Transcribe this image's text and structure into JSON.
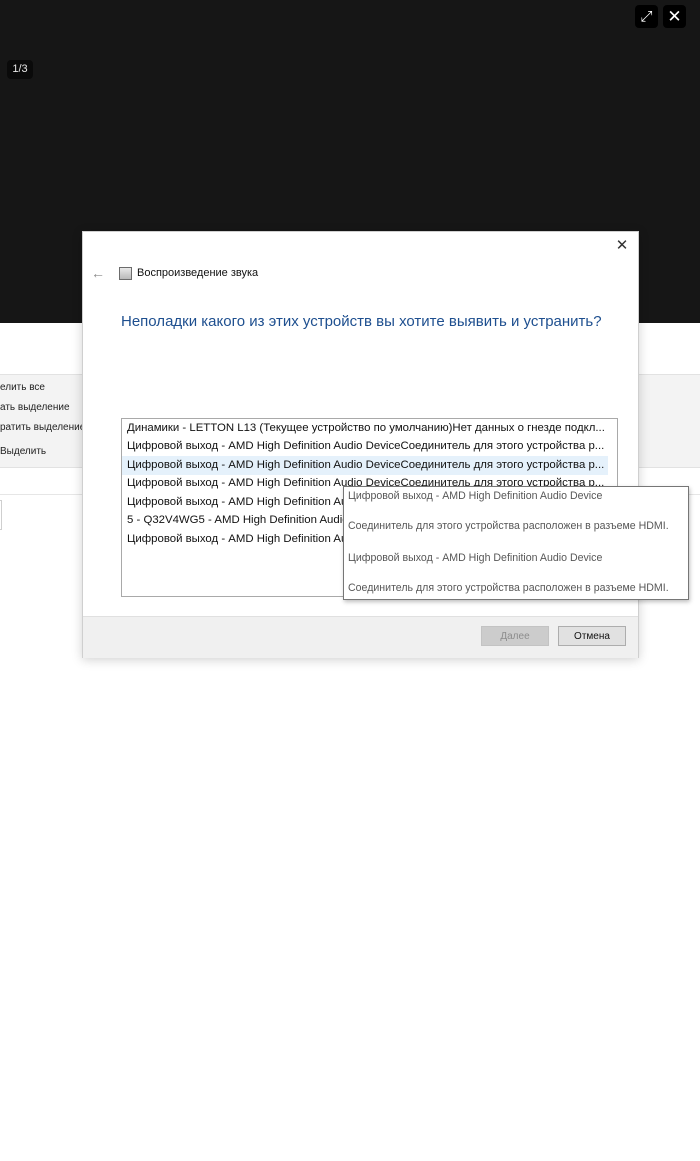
{
  "viewer": {
    "counter": "1/3",
    "expand_icon": "expand-icon",
    "close_icon": "close-icon"
  },
  "background_app": {
    "items": [
      "елить все",
      "ать выделение",
      "ратить выделение",
      "Выделить"
    ]
  },
  "dialog": {
    "title": "Воспроизведение звука",
    "heading": "Неполадки какого из этих устройств вы хотите выявить и устранить?",
    "devices": [
      "Динамики - LETTON  L13 (Текущее устройство по умолчанию)Нет данных о гнезде подкл...",
      "Цифровой выход - AMD High Definition Audio DeviceСоединитель для этого устройства р...",
      "Цифровой выход - AMD High Definition Audio DeviceСоединитель для этого устройства р...",
      "Цифровой выход - AMD High Definition Audio DeviceСоединитель для этого устройства р...",
      "Цифровой выход - AMD High Definition Audio Device",
      "5 - Q32V4WG5 - AMD High Definition Audio Device",
      "Цифровой выход - AMD High Definition Audio Device"
    ],
    "selected_index": 2,
    "next_label": "Далее",
    "cancel_label": "Отмена"
  },
  "tooltip": {
    "lines": [
      "Цифровой выход - AMD High Definition Audio Device",
      "Соединитель для этого устройства расположен в разъеме HDMI.",
      "Цифровой выход - AMD High Definition Audio Device",
      "Соединитель для этого устройства расположен в разъеме HDMI."
    ]
  },
  "colors": {
    "viewer_background": "#161616",
    "heading": "#1e4f8f",
    "selection": "#e5f1fb"
  }
}
